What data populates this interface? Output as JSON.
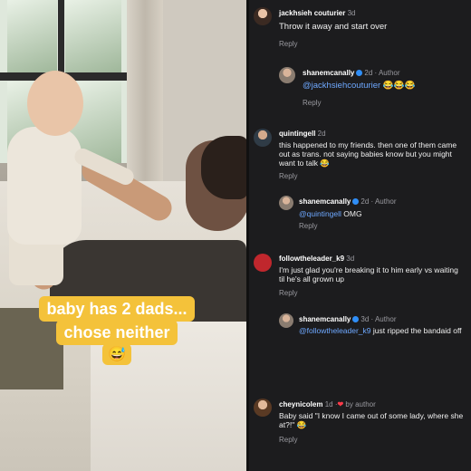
{
  "video": {
    "caption_line1": "baby has 2 dads...",
    "caption_line2": "chose neither",
    "caption_emoji": "😅"
  },
  "comments": [
    {
      "user": "jackhsieh couturier",
      "meta": "3d",
      "text": "Throw it away and start over",
      "reply": "Reply"
    },
    {
      "user": "shanemcanally",
      "badge": "verified-icon",
      "meta": "2d · Author",
      "mention": "@jackhsiehcouturier",
      "text": " 😂😂😂",
      "reply": "Reply"
    },
    {
      "user": "quintingell",
      "meta": "2d",
      "text": "this happened to my friends. then one of them came out as trans. not saying babies know but you might want to talk 😂",
      "reply": "Reply"
    },
    {
      "user": "shanemcanally",
      "badge": "verified-icon",
      "meta": "2d · Author",
      "mention": "@quintingell",
      "text": " OMG",
      "reply": "Reply"
    },
    {
      "user": "followtheleader_k9",
      "meta": "3d",
      "text": "I'm just glad you're breaking it to him early vs waiting til he's all grown up",
      "reply": "Reply"
    },
    {
      "user": "shanemcanally",
      "badge": "verified-icon",
      "meta": "3d · Author",
      "mention": "@followtheleader_k9",
      "text": " just ripped the bandaid off",
      "reply": "Reply"
    },
    {
      "user": "cheynicolem",
      "meta": "1d ·",
      "heart": "❤",
      "meta2": " by author",
      "text": "Baby said \"I know I came out of some lady, where she at?!\" 😂",
      "reply": "Reply"
    }
  ]
}
